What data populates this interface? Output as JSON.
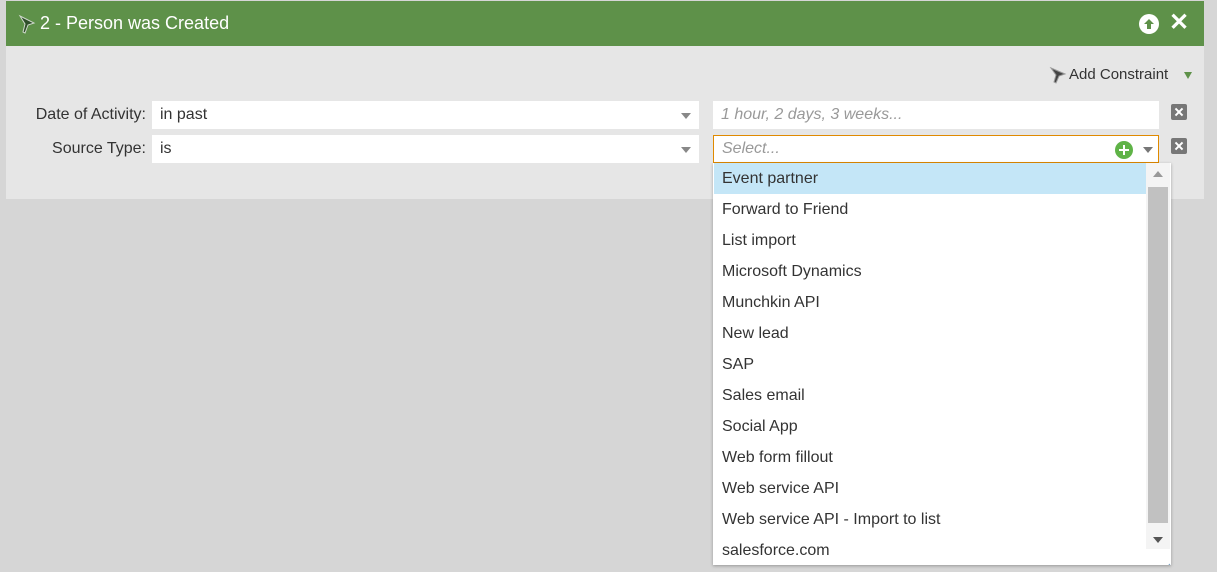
{
  "header": {
    "title": "2 - Person was Created",
    "color": "#5e9149",
    "icons": [
      "funnel-icon",
      "move-up-icon",
      "close-icon"
    ]
  },
  "toolbar": {
    "add_constraint_label": "Add Constraint"
  },
  "constraints": [
    {
      "label": "Date of Activity:",
      "operator": "in past",
      "value_placeholder": "1 hour, 2 days, 3 weeks..."
    },
    {
      "label": "Source Type:",
      "operator": "is",
      "value_placeholder": "Select..."
    }
  ],
  "dropdown": {
    "items": [
      "Event partner",
      "Forward to Friend",
      "List import",
      "Microsoft Dynamics",
      "Munchkin API",
      "New lead",
      "SAP",
      "Sales email",
      "Social App",
      "Web form fillout",
      "Web service API",
      "Web service API - Import to list",
      "salesforce.com"
    ],
    "highlighted_item": "Event partner",
    "highlight_color": "#c4e6f7"
  }
}
